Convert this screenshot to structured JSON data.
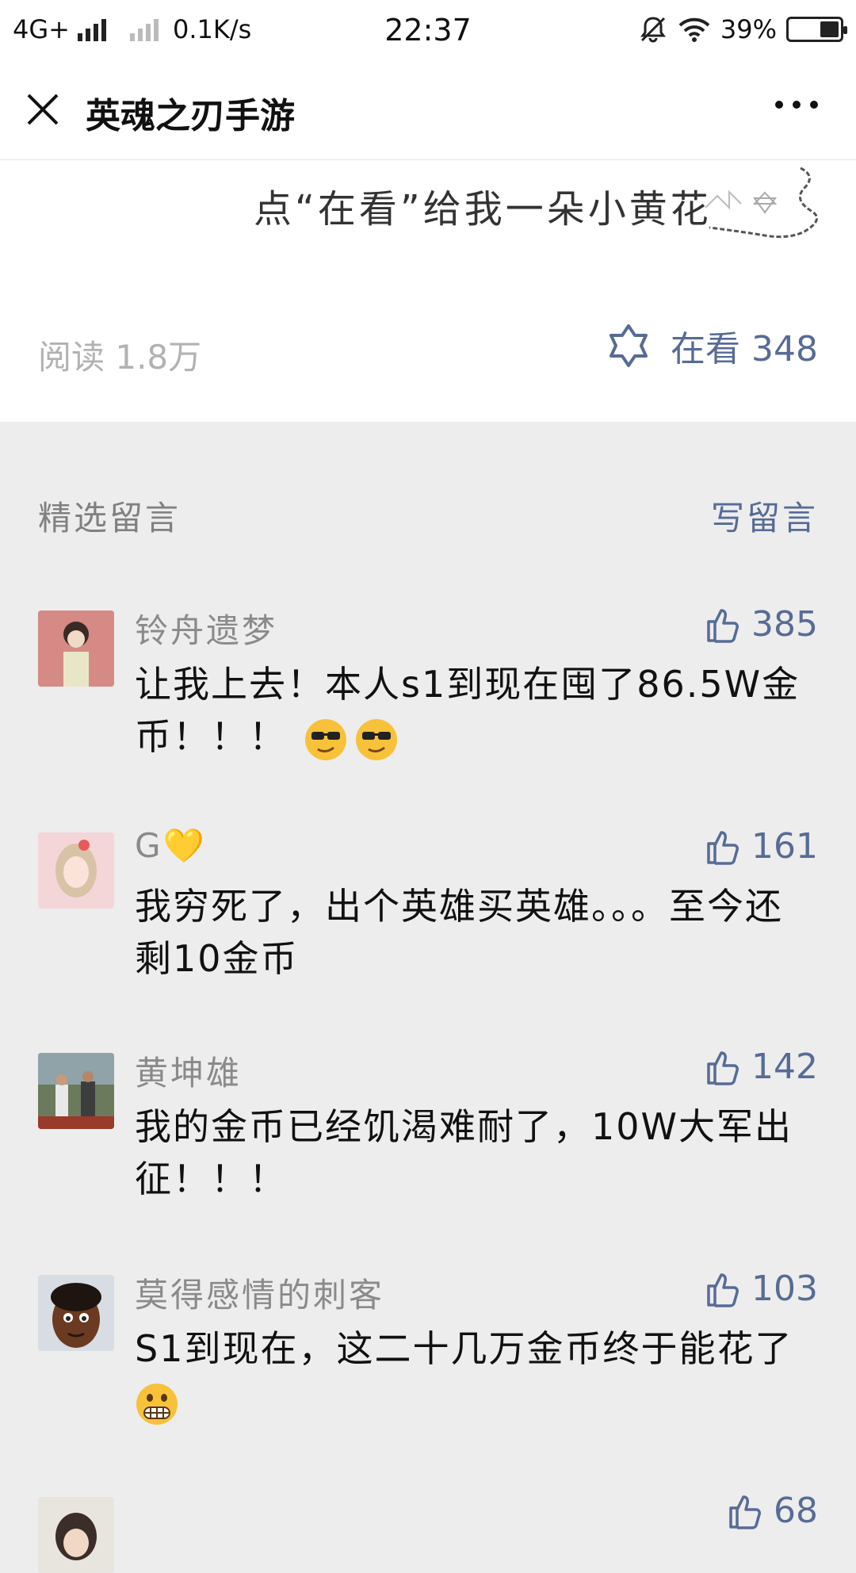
{
  "status_bar": {
    "network": "4G+",
    "speed": "0.1K/s",
    "time": "22:37",
    "battery": "39%",
    "battery_level": 0.39
  },
  "nav": {
    "title": "英魂之刃手游"
  },
  "article": {
    "promo_text": "点“在看”给我一朵小黄花",
    "reads": "阅读 1.8万",
    "in_watch": "在看 348"
  },
  "comments_section": {
    "title": "精选留言",
    "write_label": "写留言",
    "items": [
      {
        "name": "铃舟遗梦",
        "likes": "385",
        "text": "让我上去！本人s1到现在囤了86.5W金币！！！",
        "emojis": [
          "cool-smirk-emoji",
          "cool-smirk-emoji"
        ]
      },
      {
        "name": "G💛",
        "likes": "161",
        "text": "我穷死了，出个英雄买英雄。。。至今还剩10金币"
      },
      {
        "name": "黄坤雄",
        "likes": "142",
        "text": "我的金币已经饥渴难耐了，10W大军出征！！！"
      },
      {
        "name": "莫得感情的刺客",
        "likes": "103",
        "text": "S1到现在，这二十几万金币终于能花了",
        "emojis": [
          "grimace-emoji"
        ]
      },
      {
        "name": "",
        "likes": "68",
        "text": ""
      }
    ]
  },
  "colors": {
    "link": "#576b95",
    "muted": "#8a8a8a",
    "background": "#ededed"
  }
}
